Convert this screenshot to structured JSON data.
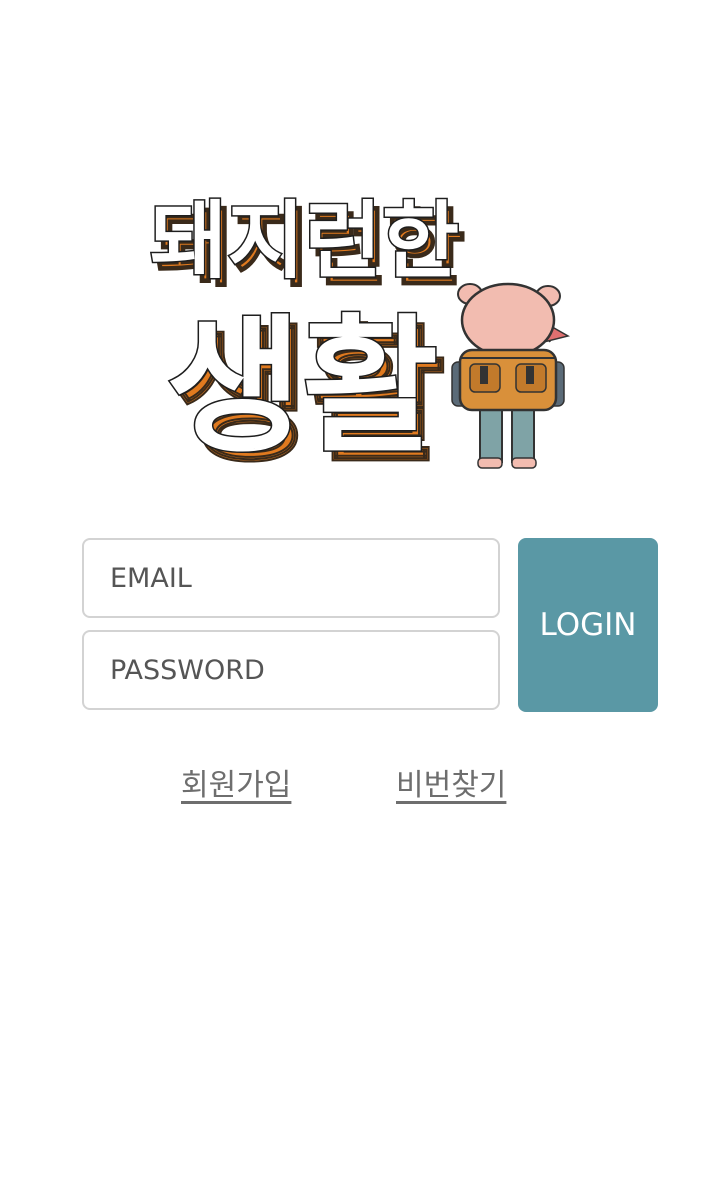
{
  "logo": {
    "line1": "돼지런한",
    "line2": "생활",
    "icon": "pig-backpacker-mascot"
  },
  "form": {
    "email_placeholder": "EMAIL",
    "password_placeholder": "PASSWORD",
    "login_label": "LOGIN"
  },
  "links": {
    "signup": "회원가입",
    "find_password": "비번찾기"
  },
  "colors": {
    "accent": "#5a98a5",
    "logo_shadow": "#e07a1f",
    "mascot_pink": "#f2bcb0",
    "backpack": "#d9903a",
    "pants": "#7fa3a6"
  }
}
